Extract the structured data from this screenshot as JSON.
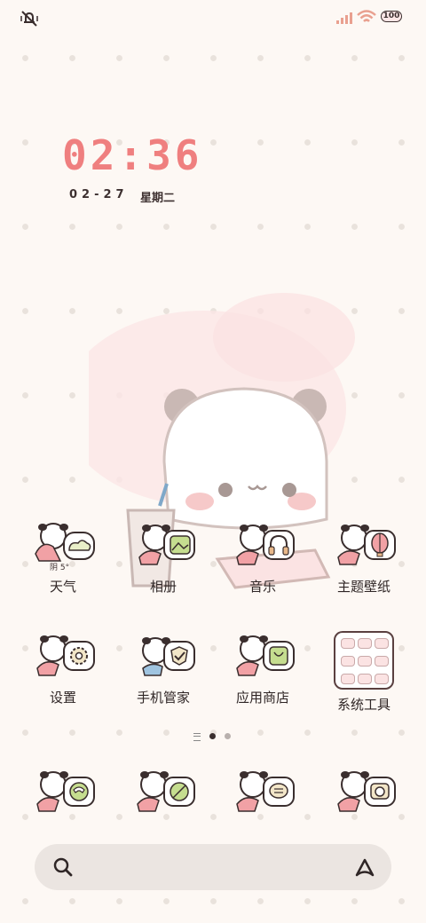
{
  "status_bar": {
    "battery": "100"
  },
  "clock": {
    "time": "02:36",
    "date": "02-27",
    "weekday": "星期二"
  },
  "home_apps": [
    {
      "label": "天气",
      "icon": "weather-icon",
      "sublabel": "阴 5°"
    },
    {
      "label": "相册",
      "icon": "gallery-icon"
    },
    {
      "label": "音乐",
      "icon": "music-icon"
    },
    {
      "label": "主题壁纸",
      "icon": "themes-icon"
    },
    {
      "label": "设置",
      "icon": "settings-icon"
    },
    {
      "label": "手机管家",
      "icon": "security-icon"
    },
    {
      "label": "应用商店",
      "icon": "app-store-icon"
    },
    {
      "label": "系统工具",
      "icon": "system-tools-folder-icon"
    }
  ],
  "dock": [
    {
      "icon": "phone-icon"
    },
    {
      "icon": "browser-icon"
    },
    {
      "icon": "messages-icon"
    },
    {
      "icon": "camera-icon"
    }
  ],
  "page_indicator": {
    "page_count": 2,
    "current_page": 1
  },
  "colors": {
    "accent": "#ef7f7f",
    "icon_green": "#c5dd8f",
    "background": "#fdf8f4"
  }
}
